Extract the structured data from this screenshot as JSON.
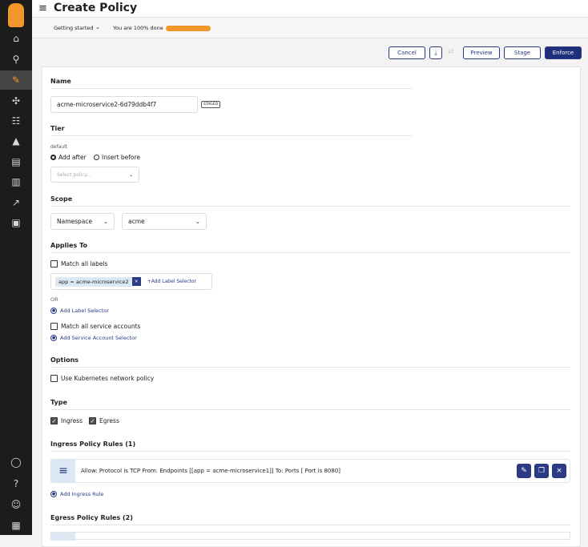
{
  "header": {
    "title": "Create Policy"
  },
  "subheader": {
    "getting_started": "Getting started",
    "progress_text": "You are 100% done",
    "progress": 1.0,
    "progress_color": "#f0962a"
  },
  "toolbar": {
    "cancel": "Cancel",
    "preview": "Preview",
    "stage": "Stage",
    "enforce": "Enforce"
  },
  "name": {
    "label": "Name",
    "value": "acme-microservice2-6d79ddb4f7",
    "badge": "STAGED"
  },
  "tier": {
    "label": "Tier",
    "value": "default",
    "add_after": "Add after",
    "insert_before": "Insert before",
    "select_placeholder": "Select policy..."
  },
  "scope": {
    "label": "Scope",
    "type": "Namespace",
    "namespace": "acme"
  },
  "applies_to": {
    "label": "Applies To",
    "match_all_labels": "Match all labels",
    "label_chip": "app = acme-microservice2",
    "add_label_inline": "+Add Label Selector",
    "or": "OR",
    "add_label_selector": "Add Label Selector",
    "match_all_sa": "Match all service accounts",
    "add_sa_selector": "Add Service Account Selector"
  },
  "options": {
    "label": "Options",
    "use_k8s": "Use Kubernetes network policy"
  },
  "type": {
    "label": "Type",
    "ingress": "Ingress",
    "egress": "Egress"
  },
  "ingress": {
    "label": "Ingress Policy Rules (1)",
    "rule": "Allow:  Protocol is TCP   From:  Endpoints [[app = acme-microservice1]]   To:  Ports [ Port is 8080]",
    "add": "Add Ingress Rule"
  },
  "egress": {
    "label": "Egress Policy Rules (2)"
  }
}
